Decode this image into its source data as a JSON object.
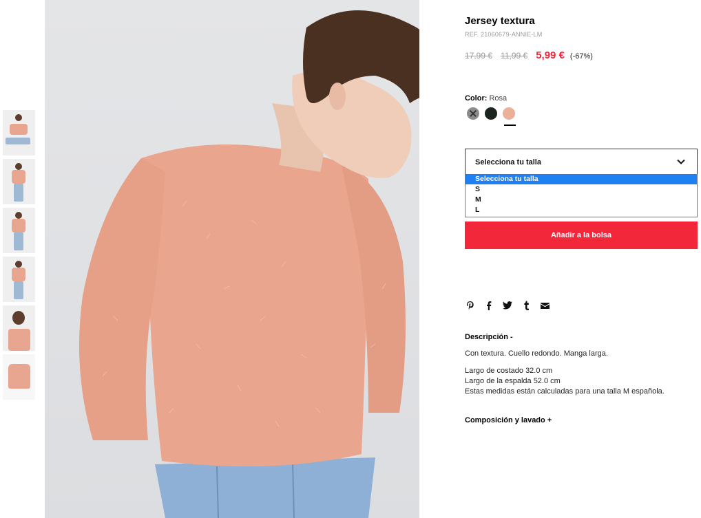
{
  "product": {
    "title": "Jersey textura",
    "ref": "REF. 21060679-ANNIE-LM",
    "price_original": "17,99 €",
    "price_previous": "11,99 €",
    "price_current": "5,99 €",
    "discount": "(-67%)"
  },
  "color": {
    "label": "Color:",
    "value": "Rosa",
    "swatches": [
      {
        "name": "grey",
        "hex": "#8b8b8b",
        "unavailable": true
      },
      {
        "name": "black",
        "hex": "#1c2420"
      },
      {
        "name": "pink",
        "hex": "#eab09a",
        "selected": true
      }
    ]
  },
  "size": {
    "selected_label": "Selecciona tu talla",
    "options": [
      "Selecciona tu talla",
      "S",
      "M",
      "L"
    ]
  },
  "add_to_bag": "Añadir a la bolsa",
  "share_icons": [
    "pinterest-icon",
    "facebook-icon",
    "twitter-icon",
    "tumblr-icon",
    "email-icon"
  ],
  "description": {
    "heading": "Descripción -",
    "summary": "Con textura. Cuello redondo. Manga larga.",
    "lines": [
      "Largo de costado 32.0 cm",
      "Largo de la espalda 52.0 cm",
      "Estas medidas están calculadas para una talla M española."
    ]
  },
  "composition": {
    "heading": "Composición y lavado +"
  },
  "colors": {
    "accent_red": "#f2273a",
    "price_red": "#e8293b",
    "dropdown_highlight": "#1f80f2"
  }
}
